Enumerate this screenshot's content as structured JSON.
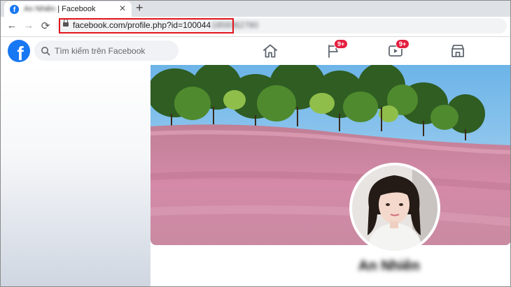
{
  "browser": {
    "tab": {
      "title_hidden": "An Nhiên",
      "title_suffix": " | Facebook",
      "close_glyph": "✕"
    },
    "new_tab_glyph": "+",
    "nav": {
      "back": "←",
      "forward": "→",
      "reload": "⟳"
    },
    "url": {
      "visible": "facebook.com/profile.php?id=100044",
      "hidden": "1859362780"
    }
  },
  "facebook": {
    "logo_letter": "f",
    "search": {
      "placeholder": "Tìm kiếm trên Facebook"
    },
    "nav_icons": [
      {
        "name": "home-icon"
      },
      {
        "name": "pages-flag-icon",
        "badge": "9+"
      },
      {
        "name": "watch-icon",
        "badge": "9+"
      },
      {
        "name": "marketplace-icon"
      }
    ],
    "profile": {
      "name": "An Nhiên"
    },
    "colors": {
      "brand": "#1877f2",
      "badge": "#e41e3f",
      "highlight": "#e3141c"
    }
  }
}
